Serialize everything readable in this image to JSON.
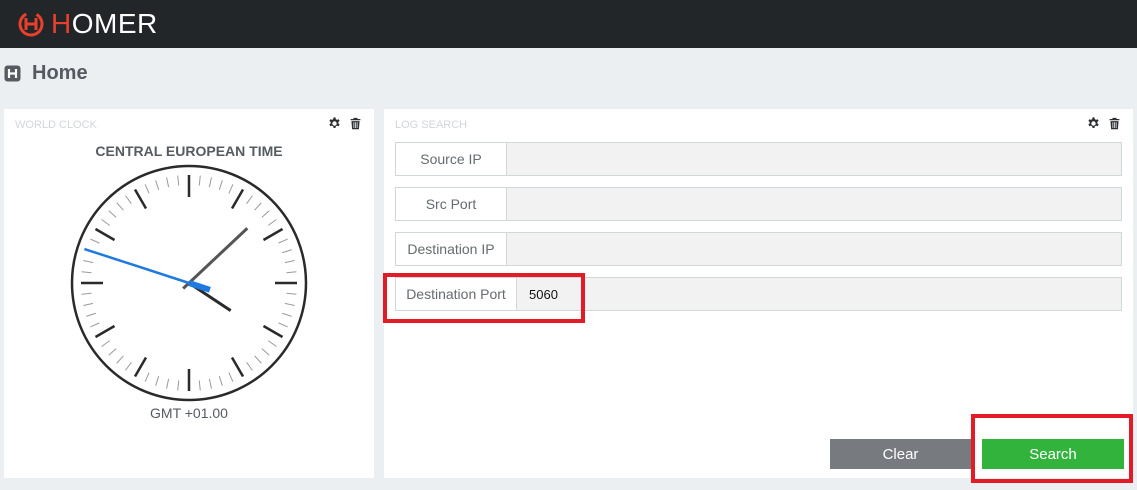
{
  "app": {
    "brand_first": "H",
    "brand_rest": "OMER",
    "brand_color": "#e8402c",
    "topbar_color": "#222629"
  },
  "page": {
    "title": "Home",
    "icon": "homer-h-icon"
  },
  "world_clock": {
    "title": "WORLD CLOCK",
    "timezone_name": "CENTRAL EUROPEAN TIME",
    "offset_label": "GMT +01.00",
    "tools": [
      "gear-icon",
      "trash-icon"
    ],
    "time": {
      "hours": 4,
      "minutes": 7,
      "seconds": 48
    },
    "second_hand_color": "#1f7ae0"
  },
  "log_search": {
    "title": "LOG SEARCH",
    "tools": [
      "gear-icon",
      "trash-icon"
    ],
    "fields": [
      {
        "label": "Source IP",
        "value": ""
      },
      {
        "label": "Src Port",
        "value": ""
      },
      {
        "label": "Destination IP",
        "value": ""
      },
      {
        "label": "Destination Port",
        "value": "5060"
      }
    ],
    "buttons": {
      "clear": "Clear",
      "search": "Search"
    },
    "colors": {
      "clear": "#777b7f",
      "search": "#32b33c",
      "highlight": "#e21b26"
    }
  }
}
